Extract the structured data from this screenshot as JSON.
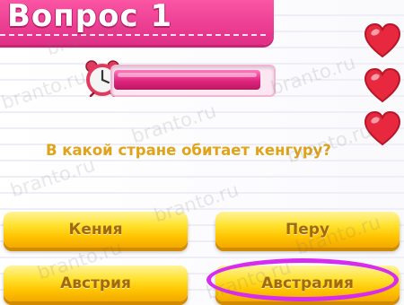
{
  "header": {
    "title": "Вопрос 1"
  },
  "timer": {
    "progress_fraction": 0.95
  },
  "lives": {
    "count": 3
  },
  "question": {
    "text": "В какой стране обитает кенгуру?"
  },
  "answers": [
    {
      "label": "Кения"
    },
    {
      "label": "Перу"
    },
    {
      "label": "Австрия"
    },
    {
      "label": "Австралия",
      "highlighted": true
    }
  ],
  "watermark": {
    "text": "branto.ru"
  },
  "colors": {
    "header_pink": "#e02e86",
    "button_yellow": "#ffd21a",
    "button_text": "#a06a12",
    "question_text": "#e0a31a",
    "highlight_ring": "#d62bf0",
    "heart_red": "#e8283e"
  },
  "icons": [
    "alarm-clock-icon",
    "heart-icon"
  ]
}
